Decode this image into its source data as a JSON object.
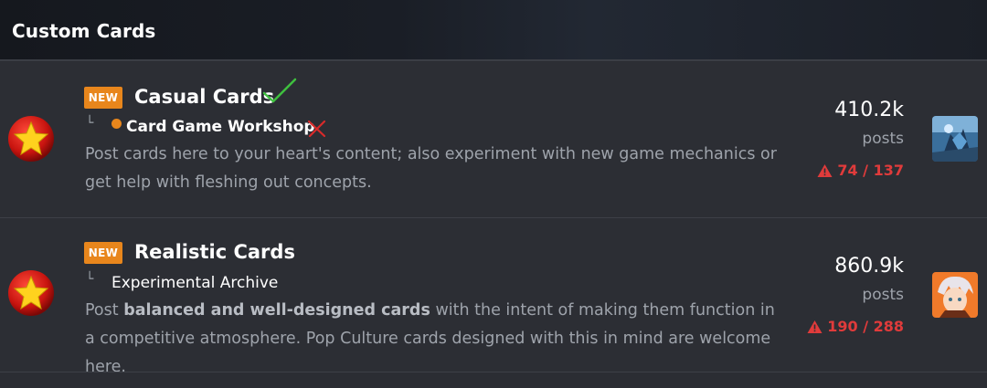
{
  "category": {
    "title": "Custom Cards"
  },
  "forums": [
    {
      "badge": "NEW",
      "title": "Casual Cards",
      "subforum_tree": "└",
      "subforum": "Card Game Workshop",
      "description": "Post cards here to your heart's content; also experiment with new game mechanics or get help with fleshing out concepts.",
      "posts_count": "410.2k",
      "posts_label": "posts",
      "reports": "74 / 137",
      "icon": "star-icon",
      "avatar": "avatar-thumbnail"
    },
    {
      "badge": "NEW",
      "title": "Realistic Cards",
      "subforum_tree": "└",
      "subforum": "Experimental Archive",
      "description_parts": {
        "pre": "Post ",
        "bold": "balanced and well-designed cards",
        "post": " with the intent of making them function in a competitive atmosphere. Pop Culture cards designed with this in mind are welcome here."
      },
      "posts_count": "860.9k",
      "posts_label": "posts",
      "reports": "190 / 288",
      "icon": "star-icon",
      "avatar": "avatar-thumbnail"
    }
  ],
  "colors": {
    "badge": "#e8861c",
    "report": "#e03b3b",
    "check": "#3fbf3f",
    "x": "#d82a2a"
  }
}
